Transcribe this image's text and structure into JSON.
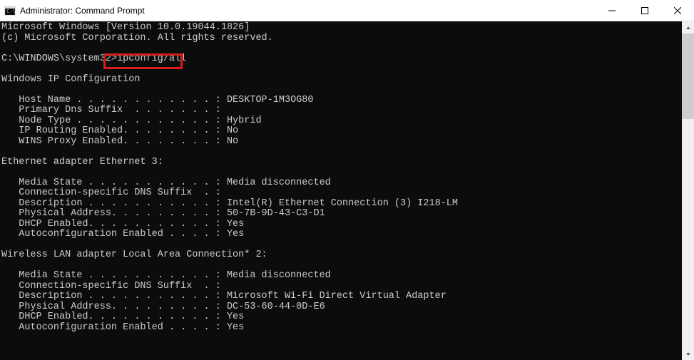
{
  "window": {
    "title": "Administrator: Command Prompt"
  },
  "terminal": {
    "line_version": "Microsoft Windows [Version 10.0.19044.1826]",
    "line_copyright": "(c) Microsoft Corporation. All rights reserved.",
    "prompt_path": "C:\\WINDOWS\\system32",
    "prompt_char": ">",
    "command": "ipconfig/all",
    "section_header": "Windows IP Configuration",
    "host_config": {
      "host_name_label": "   Host Name . . . . . . . . . . . . : ",
      "host_name_value": "DESKTOP-1M3OG80",
      "primary_dns_label": "   Primary Dns Suffix  . . . . . . . :",
      "primary_dns_value": "",
      "node_type_label": "   Node Type . . . . . . . . . . . . : ",
      "node_type_value": "Hybrid",
      "ip_routing_label": "   IP Routing Enabled. . . . . . . . : ",
      "ip_routing_value": "No",
      "wins_proxy_label": "   WINS Proxy Enabled. . . . . . . . : ",
      "wins_proxy_value": "No"
    },
    "adapter1": {
      "header": "Ethernet adapter Ethernet 3:",
      "media_state_label": "   Media State . . . . . . . . . . . : ",
      "media_state_value": "Media disconnected",
      "conn_dns_label": "   Connection-specific DNS Suffix  . :",
      "conn_dns_value": "",
      "description_label": "   Description . . . . . . . . . . . : ",
      "description_value": "Intel(R) Ethernet Connection (3) I218-LM",
      "physical_addr_label": "   Physical Address. . . . . . . . . : ",
      "physical_addr_value": "50-7B-9D-43-C3-D1",
      "dhcp_label": "   DHCP Enabled. . . . . . . . . . . : ",
      "dhcp_value": "Yes",
      "autoconfig_label": "   Autoconfiguration Enabled . . . . : ",
      "autoconfig_value": "Yes"
    },
    "adapter2": {
      "header": "Wireless LAN adapter Local Area Connection* 2:",
      "media_state_label": "   Media State . . . . . . . . . . . : ",
      "media_state_value": "Media disconnected",
      "conn_dns_label": "   Connection-specific DNS Suffix  . :",
      "conn_dns_value": "",
      "description_label": "   Description . . . . . . . . . . . : ",
      "description_value": "Microsoft Wi-Fi Direct Virtual Adapter",
      "physical_addr_label": "   Physical Address. . . . . . . . . : ",
      "physical_addr_value": "DC-53-60-44-0D-E6",
      "dhcp_label": "   DHCP Enabled. . . . . . . . . . . : ",
      "dhcp_value": "Yes",
      "autoconfig_label": "   Autoconfiguration Enabled . . . . : ",
      "autoconfig_value": "Yes"
    }
  }
}
